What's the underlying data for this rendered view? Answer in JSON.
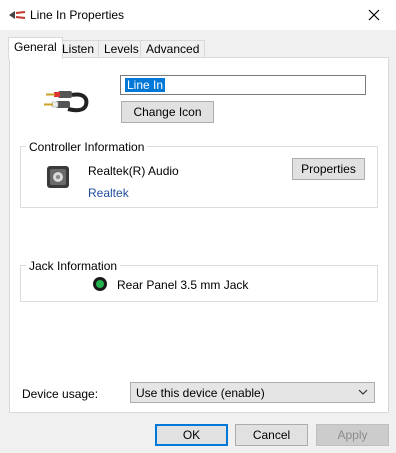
{
  "window": {
    "title": "Line In Properties"
  },
  "tabs": [
    {
      "label": "General",
      "active": true
    },
    {
      "label": "Listen",
      "active": false
    },
    {
      "label": "Levels",
      "active": false
    },
    {
      "label": "Advanced",
      "active": false
    }
  ],
  "general": {
    "name_value": "Line In",
    "change_icon_label": "Change Icon",
    "controller": {
      "heading": "Controller Information",
      "device_name": "Realtek(R) Audio",
      "vendor_link": "Realtek",
      "properties_label": "Properties"
    },
    "jack": {
      "heading": "Jack Information",
      "jack_label": "Rear Panel 3.5 mm Jack",
      "jack_color": "#22b14c"
    },
    "device_usage": {
      "label": "Device usage:",
      "selected": "Use this device (enable)"
    }
  },
  "footer": {
    "ok_label": "OK",
    "cancel_label": "Cancel",
    "apply_label": "Apply"
  },
  "colors": {
    "accent": "#0078d7",
    "link": "#1f4e9c"
  }
}
